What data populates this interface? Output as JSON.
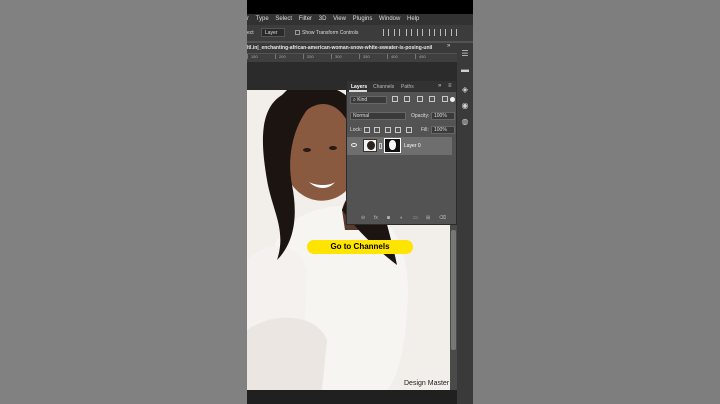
{
  "menubar": {
    "items": [
      "r",
      "Type",
      "Select",
      "Filter",
      "3D",
      "View",
      "Plugins",
      "Window",
      "Help"
    ]
  },
  "options": {
    "label": "ect",
    "layer_select": "Layer",
    "show_transform_controls": "Show Transform Controls"
  },
  "document": {
    "tab_title": "ltl.in|_enchanting-african-american-woman-snow-white-sweater-is-posing-unil",
    "ruler_ticks": [
      "150",
      "200",
      "250",
      "300",
      "350",
      "400",
      "450"
    ]
  },
  "layers_panel": {
    "tabs": [
      "Layers",
      "Channels",
      "Paths"
    ],
    "active_tab": "Layers",
    "kind_filter": "Kind",
    "blend_mode": "Normal",
    "opacity_label": "Opacity:",
    "opacity_value": "100%",
    "lock_label": "Lock:",
    "fill_label": "Fill:",
    "fill_value": "100%",
    "layers": [
      {
        "name": "Layer 0",
        "visible": true,
        "selected": true,
        "has_mask": true
      }
    ],
    "footer_icons": [
      "link-icon",
      "fx-icon",
      "mask-icon",
      "adjustment-icon",
      "group-icon",
      "new-layer-icon",
      "trash-icon"
    ]
  },
  "caption": "Go to Channels",
  "watermark": "Design Master",
  "colors": {
    "caption_bg": "#ffe400",
    "panel_bg": "#535353",
    "menubar_bg": "#323232"
  }
}
